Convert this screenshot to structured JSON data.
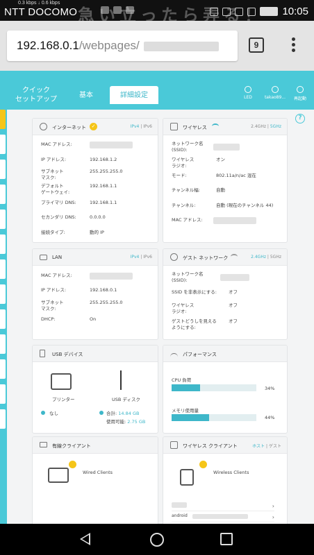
{
  "status_bar": {
    "speed": "0.3 kbps ↓   0.6 kbps",
    "carrier": "NTT DOCOMO",
    "time": "10:05",
    "overlay": "急い立ったら弄る！"
  },
  "browser": {
    "url_host": "192.168.0.1",
    "url_path": "/webpages/",
    "tab_count": "9"
  },
  "nav": {
    "tabs": [
      {
        "label": "クイック\nセットアップ"
      },
      {
        "label": "基本"
      },
      {
        "label": "詳細設定"
      }
    ],
    "right": [
      {
        "label": "LED",
        "icon": "led-icon"
      },
      {
        "label": "takao89...",
        "icon": "user-icon"
      },
      {
        "label": "再起動",
        "icon": "reboot-icon"
      }
    ]
  },
  "internet": {
    "title": "インターネット",
    "ipv4": "IPv4",
    "sep": "|",
    "ipv6": "IPv6",
    "rows": [
      {
        "label": "MAC アドレス:",
        "value": ""
      },
      {
        "label": "IP アドレス:",
        "value": "192.168.1.2"
      },
      {
        "label": "サブネット\nマスク:",
        "value": "255.255.255.0"
      },
      {
        "label": "デフォルト\nゲートウェイ:",
        "value": "192.168.1.1"
      },
      {
        "label": "プライマリ DNS:",
        "value": "192.168.1.1"
      },
      {
        "label": "セカンダリ DNS:",
        "value": "0.0.0.0"
      },
      {
        "label": "接続タイプ:",
        "value": "動的 IP"
      }
    ]
  },
  "wireless": {
    "title": "ワイヤレス",
    "band1": "2.4GHz",
    "sep": "|",
    "band2": "5GHz",
    "rows": [
      {
        "label": "ネットワーク名\n(SSID):",
        "value": ""
      },
      {
        "label": "ワイヤレス\nラジオ:",
        "value": "オン"
      },
      {
        "label": "モード:",
        "value": "802.11a/n/ac 混在"
      },
      {
        "label": "チャンネル幅:",
        "value": "自動"
      },
      {
        "label": "チャンネル:",
        "value": "自動 (現在のチャンネル 44)"
      },
      {
        "label": "MAC アドレス:",
        "value": ""
      }
    ]
  },
  "lan": {
    "title": "LAN",
    "ipv4": "IPv4",
    "sep": "|",
    "ipv6": "IPv6",
    "rows": [
      {
        "label": "MAC アドレス:",
        "value": ""
      },
      {
        "label": "IP アドレス:",
        "value": "192.168.0.1"
      },
      {
        "label": "サブネット\nマスク:",
        "value": "255.255.255.0"
      },
      {
        "label": "DHCP:",
        "value": "On"
      }
    ]
  },
  "guest": {
    "title": "ゲスト ネットワーク",
    "band1": "2.4GHz",
    "sep": "|",
    "band2": "5GHz",
    "rows": [
      {
        "label": "ネットワーク名\n(SSID):",
        "value": ""
      },
      {
        "label": "SSID を非表示にする:",
        "value": "オフ"
      },
      {
        "label": "ワイヤレス\nラジオ:",
        "value": "オフ"
      },
      {
        "label": "ゲストどうしを見える\nようにする:",
        "value": "オフ"
      }
    ]
  },
  "usb": {
    "title": "USB デバイス",
    "printer": "プリンター",
    "printer_status": "なし",
    "disk": "USB ディスク",
    "total_label": "合計:",
    "total": "14.84 GB",
    "avail_label": "使用可能:",
    "avail": "2.75 GB"
  },
  "perf": {
    "title": "パフォーマンス",
    "cpu_label": "CPU 負荷",
    "cpu_pct": "34%",
    "cpu": 0.34,
    "mem_label": "メモリ使用量",
    "mem_pct": "44%",
    "mem": 0.44
  },
  "wired": {
    "title": "有線クライアント",
    "label": "Wired Clients"
  },
  "wlclients": {
    "title": "ワイヤレス クライアント",
    "host": "ホスト",
    "sep": "|",
    "guest": "ゲスト",
    "label": "Wireless Clients",
    "items": [
      "",
      "android"
    ]
  },
  "colors": {
    "accent": "#4ac9d8",
    "yellow": "#f5c518"
  }
}
